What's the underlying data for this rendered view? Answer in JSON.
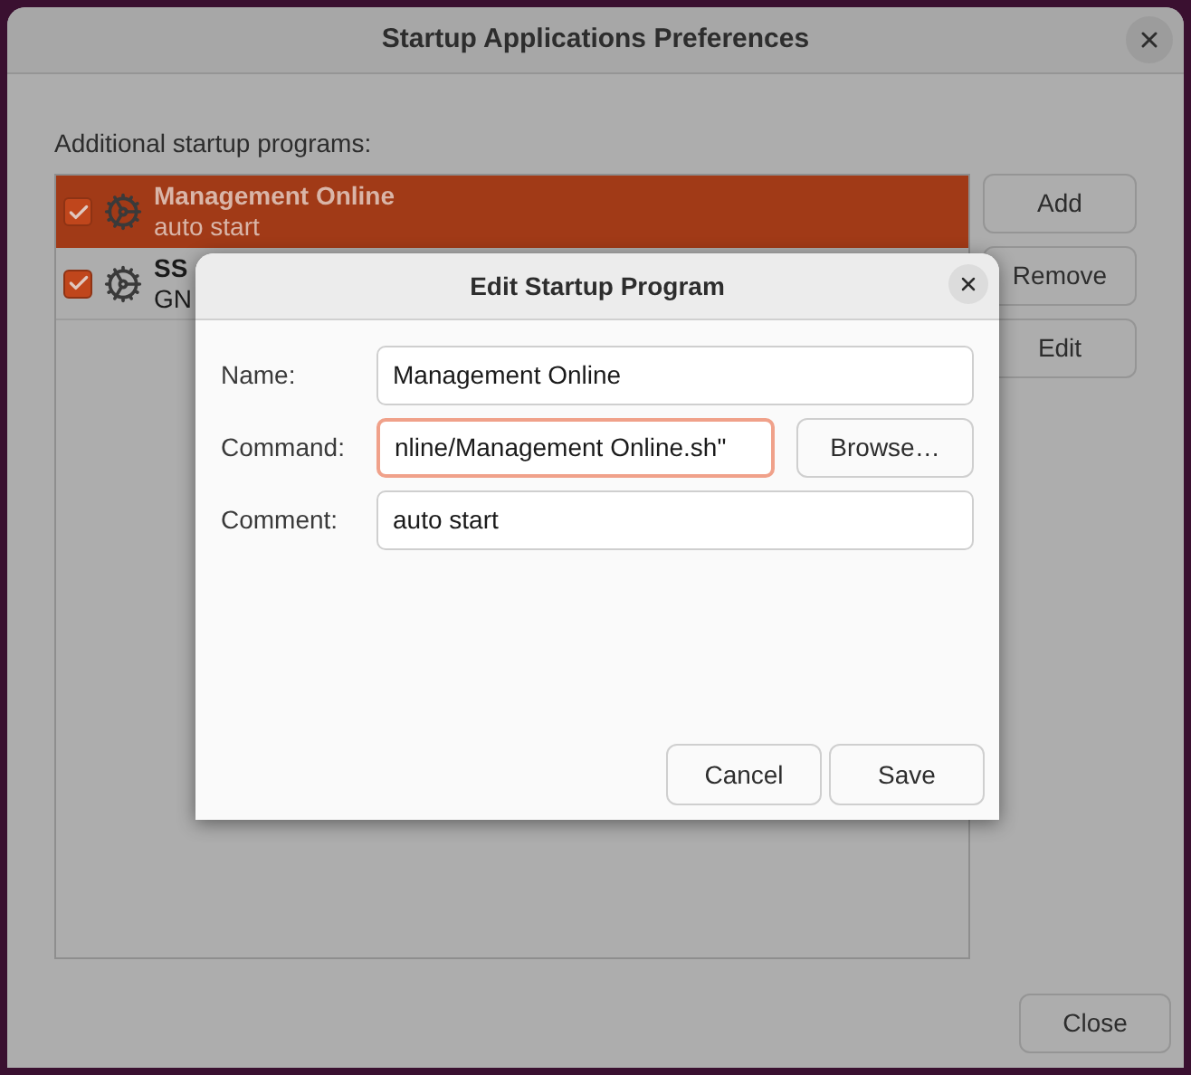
{
  "window": {
    "title": "Startup Applications Preferences"
  },
  "list_label": "Additional startup programs:",
  "programs": [
    {
      "name": "Management Online",
      "comment": "auto start",
      "checked": true,
      "selected": true
    },
    {
      "name": "SS",
      "comment": "GN",
      "checked": true,
      "selected": false
    }
  ],
  "side_buttons": [
    "Add",
    "Remove",
    "Edit"
  ],
  "close_button": "Close",
  "dialog": {
    "title": "Edit Startup Program",
    "fields": [
      {
        "label": "Name:",
        "value": "Management Online",
        "focused": false
      },
      {
        "label": "Command:",
        "value": "nline/Management Online.sh\"",
        "focused": true,
        "button": "Browse…"
      },
      {
        "label": "Comment:",
        "value": "auto start",
        "focused": false
      }
    ],
    "buttons": [
      "Cancel",
      "Save"
    ]
  }
}
